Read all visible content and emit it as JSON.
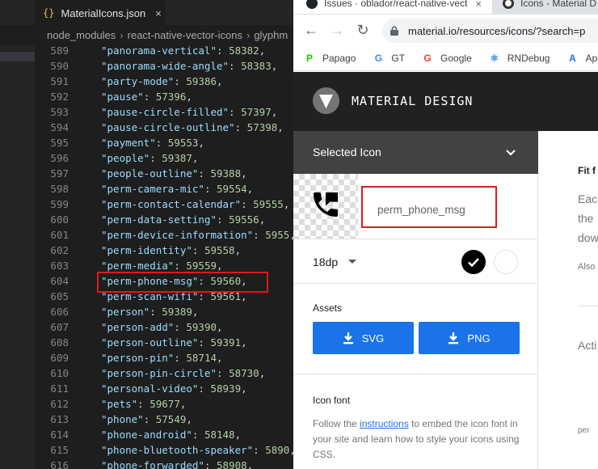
{
  "vscode": {
    "tab_label": "MaterialIcons.json",
    "tab_icon": "{}",
    "close_glyph": "×",
    "breadcrumb": [
      "node_modules",
      "react-native-vector-icons",
      "glyphm"
    ],
    "breadcrumb_sep": "›",
    "lines": [
      {
        "n": "589",
        "key": "\"panorama-vertical\"",
        "val": "58382"
      },
      {
        "n": "590",
        "key": "\"panorama-wide-angle\"",
        "val": "58383"
      },
      {
        "n": "591",
        "key": "\"party-mode\"",
        "val": "59386"
      },
      {
        "n": "592",
        "key": "\"pause\"",
        "val": "57396"
      },
      {
        "n": "593",
        "key": "\"pause-circle-filled\"",
        "val": "57397"
      },
      {
        "n": "594",
        "key": "\"pause-circle-outline\"",
        "val": "57398"
      },
      {
        "n": "595",
        "key": "\"payment\"",
        "val": "59553"
      },
      {
        "n": "596",
        "key": "\"people\"",
        "val": "59387"
      },
      {
        "n": "597",
        "key": "\"people-outline\"",
        "val": "59388"
      },
      {
        "n": "598",
        "key": "\"perm-camera-mic\"",
        "val": "59554"
      },
      {
        "n": "599",
        "key": "\"perm-contact-calendar\"",
        "val": "59555"
      },
      {
        "n": "600",
        "key": "\"perm-data-setting\"",
        "val": "59556"
      },
      {
        "n": "601",
        "key": "\"perm-device-information\"",
        "val": "5955"
      },
      {
        "n": "602",
        "key": "\"perm-identity\"",
        "val": "59558"
      },
      {
        "n": "603",
        "key": "\"perm-media\"",
        "val": "59559"
      },
      {
        "n": "604",
        "key": "\"perm-phone-msg\"",
        "val": "59560"
      },
      {
        "n": "605",
        "key": "\"perm-scan-wifi\"",
        "val": "59561"
      },
      {
        "n": "606",
        "key": "\"person\"",
        "val": "59389"
      },
      {
        "n": "607",
        "key": "\"person-add\"",
        "val": "59390"
      },
      {
        "n": "608",
        "key": "\"person-outline\"",
        "val": "59391"
      },
      {
        "n": "609",
        "key": "\"person-pin\"",
        "val": "58714"
      },
      {
        "n": "610",
        "key": "\"person-pin-circle\"",
        "val": "58730"
      },
      {
        "n": "611",
        "key": "\"personal-video\"",
        "val": "58939"
      },
      {
        "n": "612",
        "key": "\"pets\"",
        "val": "59677"
      },
      {
        "n": "613",
        "key": "\"phone\"",
        "val": "57549"
      },
      {
        "n": "614",
        "key": "\"phone-android\"",
        "val": "58148"
      },
      {
        "n": "615",
        "key": "\"phone-bluetooth-speaker\"",
        "val": "5890"
      },
      {
        "n": "616",
        "key": "\"phone-forwarded\"",
        "val": "58908"
      }
    ]
  },
  "browser": {
    "tabs": [
      {
        "label": "Issues · oblador/react-native-vect",
        "icon": "github-icon"
      },
      {
        "label": "Icons - Material D",
        "icon": "material-icon"
      }
    ],
    "tab_close": "×",
    "url": "material.io/resources/icons/?search=p",
    "nav": {
      "back": "←",
      "forward": "→",
      "reload": "↻"
    },
    "bookmarks": [
      {
        "label": "Papago",
        "icon": "papago-icon",
        "glyph": "P",
        "color": "#1ec800"
      },
      {
        "label": "GT",
        "icon": "google-translate-icon",
        "glyph": "G",
        "color": "#4285f4"
      },
      {
        "label": "Google",
        "icon": "google-icon",
        "glyph": "G",
        "color": "#ea4335"
      },
      {
        "label": "RNDebug",
        "icon": "react-icon",
        "glyph": "⚛",
        "color": "#3a8ee6"
      },
      {
        "label": "AppLis",
        "icon": "appstore-icon",
        "glyph": "A",
        "color": "#1a73e8"
      }
    ]
  },
  "material": {
    "site_title": "MATERIAL DESIGN",
    "panel_title": "Selected Icon",
    "icon_name": "perm_phone_msg",
    "size": "18dp",
    "assets_label": "Assets",
    "btn_svg": "SVG",
    "btn_png": "PNG",
    "iconfont_label": "Icon font",
    "iconfont_text_pre": "Follow the ",
    "iconfont_link": "instructions",
    "iconfont_text_post": " to embed the icon font in your site and learn how to style your icons using CSS.",
    "peek": {
      "title": "Fit f",
      "body1": "Eac",
      "body2": "the",
      "body3": "dow",
      "also": "Also",
      "acti": "Acti",
      "per": "per"
    }
  },
  "colors": {
    "highlight": "#e01919",
    "json_key": "#9cdcfe",
    "json_number": "#b5cea8",
    "download_blue": "#1a73e8"
  }
}
